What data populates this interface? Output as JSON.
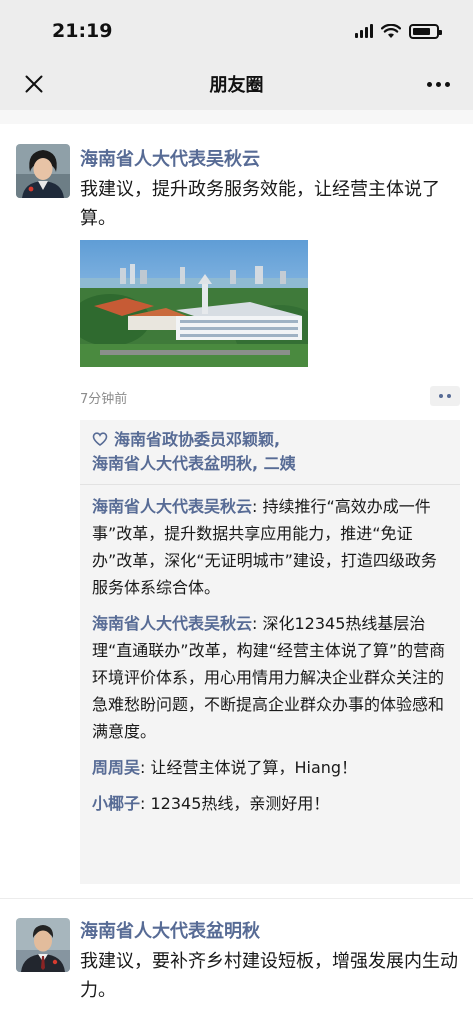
{
  "status_bar": {
    "time": "21:19",
    "battery_level": 0.75
  },
  "header": {
    "title": "朋友圈"
  },
  "posts": [
    {
      "author": "海南省人大代表吴秋云",
      "text": "我建议，提升政务服务效能，让经营主体说了算。",
      "photo": "city-campus-photo",
      "time": "7分钟前",
      "likes": "海南省政协委员邓颖颖,\n海南省人大代表盆明秋, 二姨",
      "comments": [
        {
          "name": "海南省人大代表吴秋云",
          "sep": ": ",
          "text": "持续推行“高效办成一件事”改革，提升数据共享应用能力，推进“免证办”改革，深化“无证明城市”建设，打造四级政务服务体系综合体。"
        },
        {
          "name": "海南省人大代表吴秋云",
          "sep": ": ",
          "text": "深化12345热线基层治理“直通联办”改革，构建“经营主体说了算”的营商环境评价体系，用心用情用力解决企业群众关注的急难愁盼问题，不断提高企业群众办事的体验感和满意度。"
        },
        {
          "name": "周周吴",
          "sep": ": ",
          "text": "让经营主体说了算，Hiang！"
        },
        {
          "name": "小椰子",
          "sep": ": ",
          "text": "12345热线，亲测好用！"
        }
      ]
    },
    {
      "author": "海南省人大代表盆明秋",
      "text": "我建议，要补齐乡村建设短板，增强发展内生动力。"
    }
  ],
  "colors": {
    "name_blue": "#576b95",
    "nav_bg": "#ededed",
    "comment_bg": "#f4f4f4"
  },
  "icons": {
    "close": "close-icon",
    "more": "more-dots-icon",
    "like": "heart-icon",
    "action": "action-dots-icon"
  }
}
